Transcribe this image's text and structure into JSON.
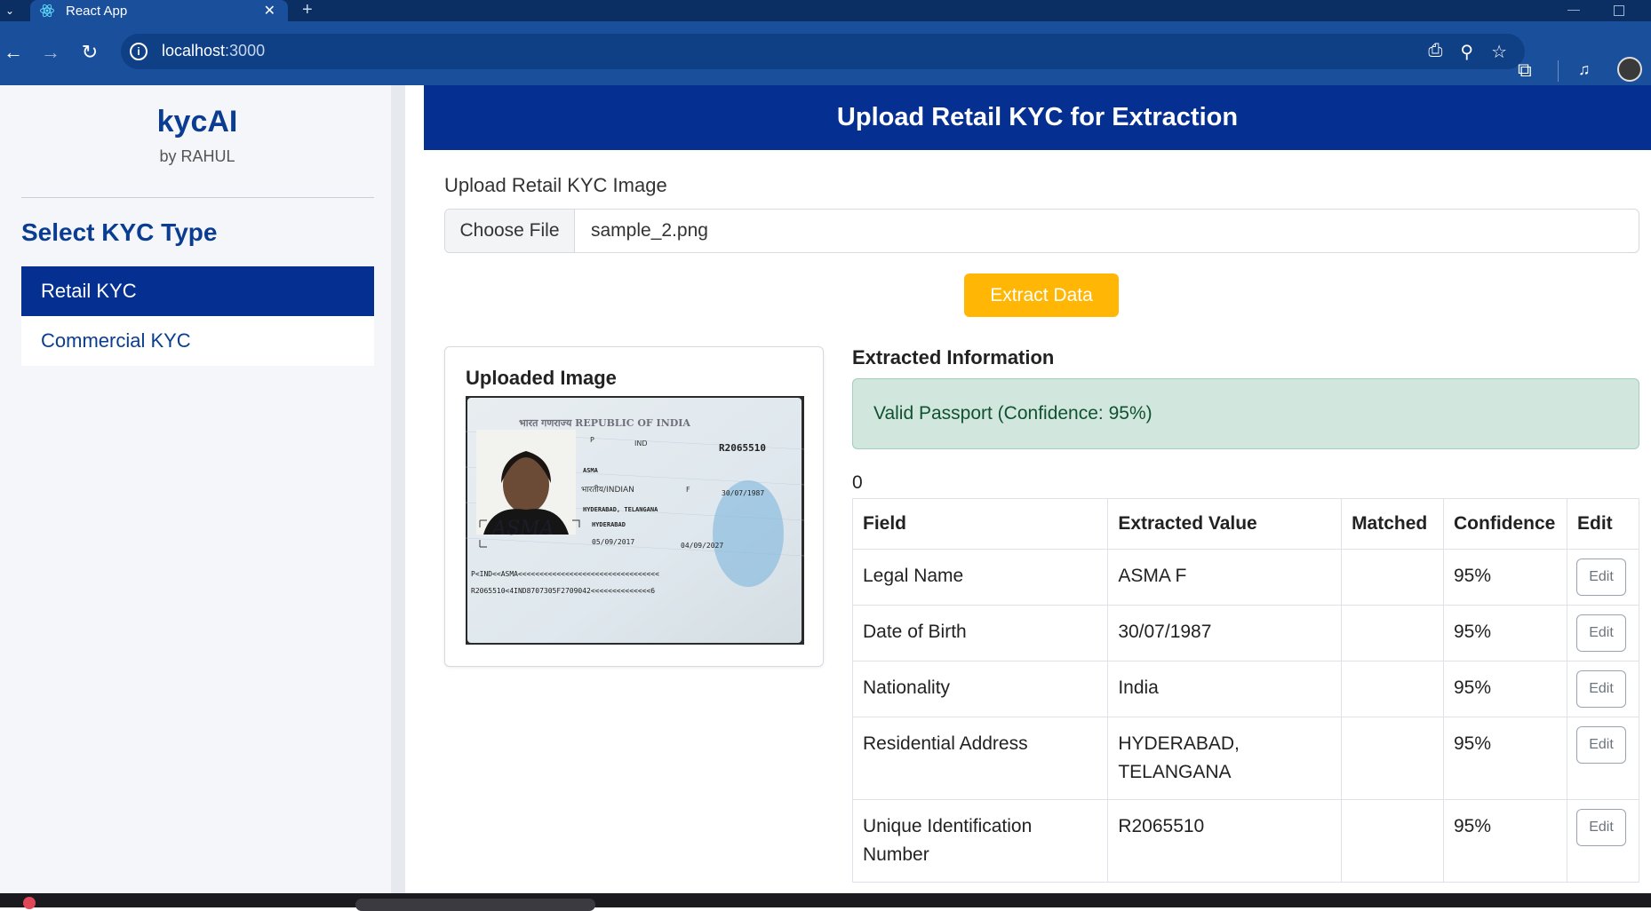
{
  "browser": {
    "tab_title": "React App",
    "url_host": "localhost",
    "url_port": ":3000"
  },
  "sidebar": {
    "brand": "kycAI",
    "brand_sub": "by RAHUL",
    "heading": "Select KYC Type",
    "items": [
      {
        "label": "Retail KYC",
        "active": true
      },
      {
        "label": "Commercial KYC",
        "active": false
      }
    ]
  },
  "main": {
    "header": "Upload Retail KYC for Extraction",
    "upload_label": "Upload Retail KYC Image",
    "choose_file": "Choose File",
    "file_name": "sample_2.png",
    "extract_button": "Extract Data",
    "image_card_title": "Uploaded Image",
    "extracted_title": "Extracted Information",
    "alert": "Valid Passport (Confidence: 95%)",
    "count": "0",
    "table": {
      "headers": [
        "Field",
        "Extracted Value",
        "Matched",
        "Confidence",
        "Edit"
      ],
      "rows": [
        {
          "field": "Legal Name",
          "value": "ASMA F",
          "matched": "",
          "confidence": "95%",
          "edit": "Edit"
        },
        {
          "field": "Date of Birth",
          "value": "30/07/1987",
          "matched": "",
          "confidence": "95%",
          "edit": "Edit"
        },
        {
          "field": "Nationality",
          "value": "India",
          "matched": "",
          "confidence": "95%",
          "edit": "Edit"
        },
        {
          "field": "Residential Address",
          "value": "HYDERABAD, TELANGANA",
          "matched": "",
          "confidence": "95%",
          "edit": "Edit"
        },
        {
          "field": "Unique Identification Number",
          "value": "R2065510",
          "matched": "",
          "confidence": "95%",
          "edit": "Edit"
        }
      ]
    }
  },
  "passport": {
    "header": "भारत गणराज्य  REPUBLIC OF INDIA",
    "type": "P",
    "country_code": "IND",
    "passport_no": "R2065510",
    "given_name": "ASMA",
    "nationality": "भारतीय/INDIAN",
    "sex": "F",
    "dob": "30/07/1987",
    "place_of_birth": "HYDERABAD, TELANGANA",
    "place_of_issue": "HYDERABAD",
    "date_of_issue": "05/09/2017",
    "date_of_expiry": "04/09/2027",
    "signature": "ASMA",
    "mrz1": "P<IND<<ASMA<<<<<<<<<<<<<<<<<<<<<<<<<<<<<<<<<",
    "mrz2": "R2065510<4IND8707305F2709042<<<<<<<<<<<<<<6"
  },
  "colors": {
    "brand_blue": "#053091",
    "accent_yellow": "#ffb605",
    "success_bg": "#d1e7dd"
  }
}
